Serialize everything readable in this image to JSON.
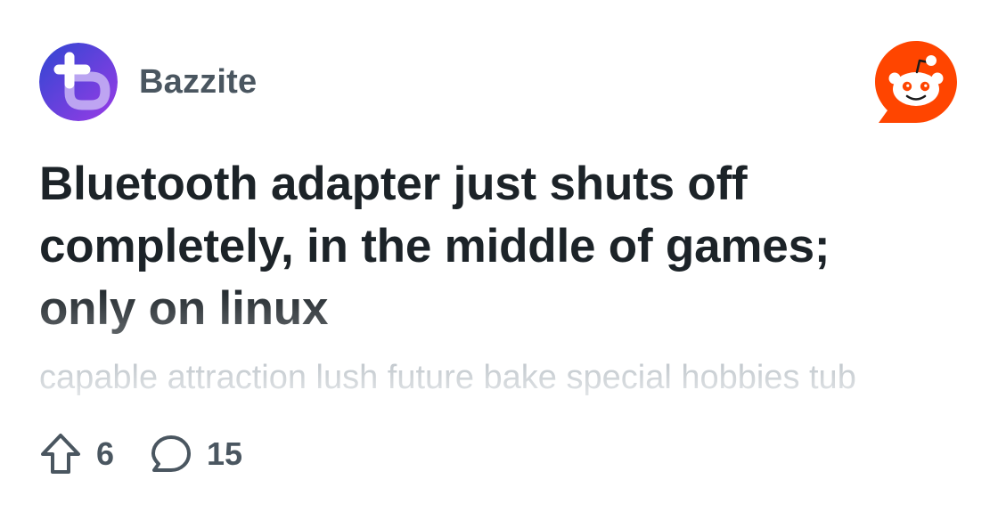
{
  "subreddit": {
    "name": "Bazzite",
    "avatar_icon": "bazzite-logo-icon",
    "avatar_gradient": [
      "#3a4fd6",
      "#8a3ce0"
    ]
  },
  "brand": {
    "logo_icon": "reddit-logo-icon",
    "color": "#ff4500"
  },
  "post": {
    "title": "Bluetooth adapter just shuts off completely, in the middle of games; only on linux",
    "body_preview": "capable attraction lush future bake special hobbies tub"
  },
  "stats": {
    "upvote_icon": "upvote-arrow-icon",
    "upvotes": "6",
    "comment_icon": "comment-bubble-icon",
    "comments": "15"
  },
  "colors": {
    "title": "#1c2328",
    "meta": "#4a5660",
    "preview": "#c4cacf"
  }
}
